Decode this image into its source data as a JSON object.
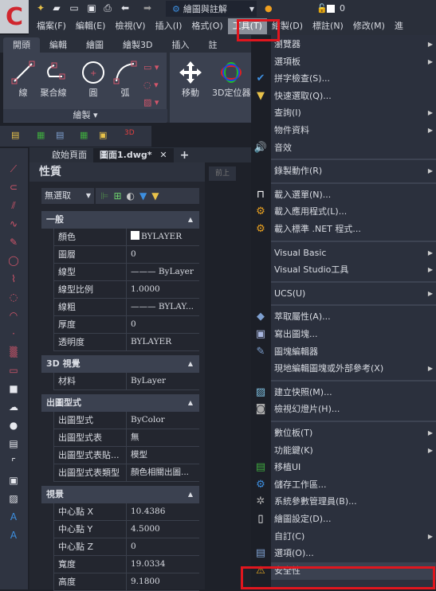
{
  "quick_access": {
    "workspace": "繪圖與註解",
    "layer_value": "0",
    "icons": [
      "new-icon",
      "open-icon",
      "save-icon",
      "save-as-icon",
      "print-icon",
      "undo-icon",
      "redo-icon"
    ]
  },
  "menubar": {
    "items": [
      "檔案(F)",
      "編輯(E)",
      "檢視(V)",
      "插入(I)",
      "格式(O)",
      "工具(T)",
      "繪製(D)",
      "標註(N)",
      "修改(M)",
      "進"
    ],
    "active": "工具(T)"
  },
  "ribbon": {
    "tabs": [
      "開頭",
      "編輯",
      "繪圖",
      "繪製3D",
      "插入",
      "註"
    ],
    "active_tab": "開頭",
    "tools": [
      "線",
      "聚合線",
      "圓",
      "弧",
      "移動",
      "3D定位器"
    ],
    "panel_label": "繪製 ▾"
  },
  "doc_tabs": [
    "啟始頁面",
    "圖面1.dwg*"
  ],
  "properties": {
    "title": "性質",
    "selection": "無選取",
    "sections": [
      {
        "name": "一般",
        "rows": [
          [
            "顏色",
            "BYLAYER"
          ],
          [
            "圖層",
            "0"
          ],
          [
            "線型",
            "——— ByLayer"
          ],
          [
            "線型比例",
            "1.0000"
          ],
          [
            "線粗",
            "——— BYLAY..."
          ],
          [
            "厚度",
            "0"
          ],
          [
            "透明度",
            "BYLAYER"
          ]
        ]
      },
      {
        "name": "3D 視覺",
        "rows": [
          [
            "材料",
            "ByLayer"
          ]
        ]
      },
      {
        "name": "出圖型式",
        "rows": [
          [
            "出圖型式",
            "ByColor"
          ],
          [
            "出圖型式表",
            "無"
          ],
          [
            "出圖型式表貼...",
            "模型"
          ],
          [
            "出圖型式表類型",
            "顏色相關出圖..."
          ]
        ]
      },
      {
        "name": "視景",
        "rows": [
          [
            "中心點 X",
            "10.4386"
          ],
          [
            "中心點 Y",
            "4.5000"
          ],
          [
            "中心點 Z",
            "0"
          ],
          [
            "寬度",
            "19.0334"
          ],
          [
            "高度",
            "9.1800"
          ]
        ]
      }
    ]
  },
  "drawing": {
    "prev_button": "前上"
  },
  "tools_menu": {
    "items": [
      {
        "label": "瀏覽器",
        "sub": true
      },
      {
        "label": "選項板",
        "sub": true
      },
      {
        "label": "拼字檢查(S)...",
        "icon": "spell-check-icon"
      },
      {
        "label": "快速選取(Q)...",
        "icon": "quick-select-icon"
      },
      {
        "label": "查詢(I)",
        "sub": true
      },
      {
        "label": "物件資料",
        "sub": true
      },
      {
        "label": "音效",
        "icon": "speaker-icon"
      },
      {
        "sep": true
      },
      {
        "label": "錄製動作(R)",
        "sub": true
      },
      {
        "sep": true
      },
      {
        "label": "載入選單(N)...",
        "icon": "menu-load-icon"
      },
      {
        "label": "載入應用程式(L)...",
        "icon": "gear-app-icon"
      },
      {
        "label": "載入標準 .NET 程式...",
        "icon": "gear-net-icon"
      },
      {
        "sep": true
      },
      {
        "label": "Visual Basic",
        "sub": true
      },
      {
        "label": "Visual Studio工具",
        "sub": true
      },
      {
        "sep": true
      },
      {
        "label": "UCS(U)",
        "sub": true
      },
      {
        "sep": true
      },
      {
        "label": "萃取屬性(A)...",
        "icon": "extract-attributes-icon"
      },
      {
        "label": "寫出圖塊...",
        "icon": "write-block-icon"
      },
      {
        "label": "圖塊編輯器",
        "icon": "block-editor-icon"
      },
      {
        "label": "現地編輯圖塊或外部參考(X)",
        "sub": true
      },
      {
        "sep": true
      },
      {
        "label": "建立快照(M)...",
        "icon": "snapshot-icon"
      },
      {
        "label": "檢視幻燈片(H)...",
        "icon": "camera-icon"
      },
      {
        "sep": true
      },
      {
        "label": "數位板(T)",
        "sub": true
      },
      {
        "label": "功能鍵(K)",
        "sub": true
      },
      {
        "label": "移植UI",
        "icon": "migrate-ui-icon"
      },
      {
        "label": "儲存工作區...",
        "icon": "save-workspace-icon"
      },
      {
        "label": "系統參數管理員(B)...",
        "icon": "sysvar-icon"
      },
      {
        "label": "繪圖設定(D)...",
        "icon": "drawing-settings-icon"
      },
      {
        "label": "自訂(C)",
        "sub": true
      },
      {
        "label": "選項(O)...",
        "icon": "options-icon"
      },
      {
        "label": "安全性",
        "icon": "warning-icon",
        "highlighted": true
      }
    ]
  },
  "colors": {
    "accent_red": "#e0161e",
    "menu_bg": "#2b303d",
    "panel_bg": "#23262f"
  }
}
